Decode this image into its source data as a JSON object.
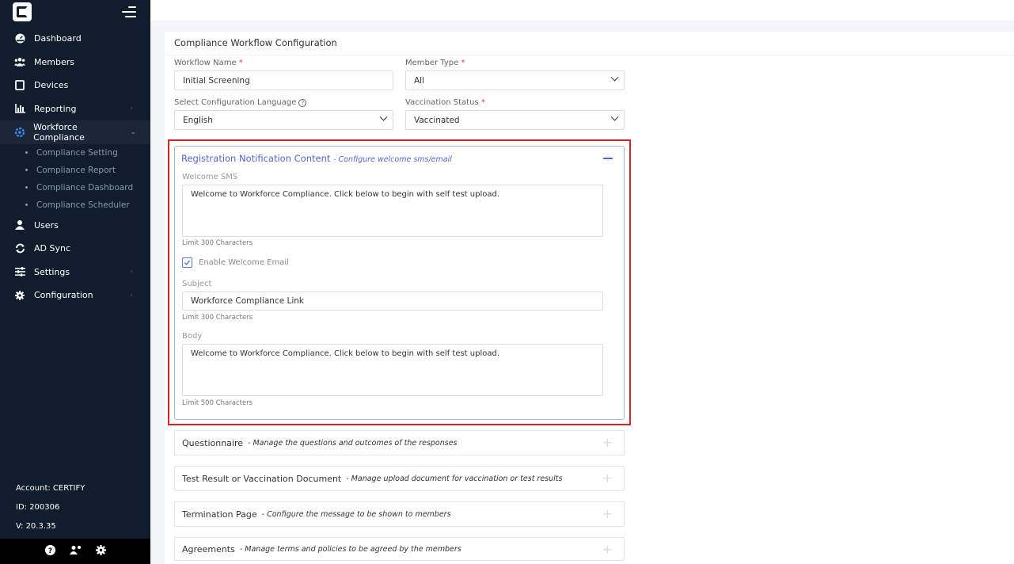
{
  "sidebar": {
    "items": [
      {
        "label": "Dashboard",
        "icon": "dashboard-icon"
      },
      {
        "label": "Members",
        "icon": "members-icon"
      },
      {
        "label": "Devices",
        "icon": "devices-icon"
      },
      {
        "label": "Reporting",
        "icon": "reporting-icon"
      },
      {
        "label": "Workforce Compliance",
        "icon": "compliance-icon"
      },
      {
        "label": "Users",
        "icon": "user-icon"
      },
      {
        "label": "AD Sync",
        "icon": "sync-icon"
      },
      {
        "label": "Settings",
        "icon": "sliders-icon"
      },
      {
        "label": "Configuration",
        "icon": "gear-icon"
      }
    ],
    "subitems": [
      "Compliance Setting",
      "Compliance Report",
      "Compliance Dashboard",
      "Compliance Scheduler"
    ],
    "account": "Account: CERTIFY",
    "id": "ID: 200306",
    "version": "V: 20.3.35"
  },
  "main": {
    "title": "Compliance Workflow Configuration",
    "workflow_name": {
      "label": "Workflow Name",
      "value": "Initial Screening"
    },
    "member_type": {
      "label": "Member Type",
      "value": "All"
    },
    "language": {
      "label": "Select Configuration Language",
      "value": "English"
    },
    "vaccination_status": {
      "label": "Vaccination Status",
      "value": "Vaccinated"
    },
    "required_mark": "*"
  },
  "registration": {
    "title": "Registration Notification Content",
    "subtitle": "- Configure welcome sms/email",
    "welcome_sms_label": "Welcome SMS",
    "welcome_sms_value": "Welcome to Workforce Compliance. Click below to begin with self test upload.",
    "sms_limit": "Limit 300 Characters",
    "enable_email_label": "Enable Welcome Email",
    "enable_email_checked": true,
    "subject_label": "Subject",
    "subject_value": "Workforce Compliance Link",
    "subject_limit": "Limit 300 Characters",
    "body_label": "Body",
    "body_value": "Welcome to Workforce Compliance. Click below to begin with self test upload.",
    "body_limit": "Limit 500 Characters"
  },
  "sections": [
    {
      "title": "Questionnaire",
      "desc": "- Manage the questions and outcomes of the responses"
    },
    {
      "title": "Test Result or Vaccination Document",
      "desc": "- Manage upload document for vaccination or test results"
    },
    {
      "title": "Termination Page",
      "desc": "- Configure the message to be shown to members"
    },
    {
      "title": "Agreements",
      "desc": "- Manage terms and policies to be agreed by the members"
    }
  ],
  "colors": {
    "sidebar": "#0f1d2d",
    "accent": "#5566d6",
    "highlight": "#d6252a"
  }
}
